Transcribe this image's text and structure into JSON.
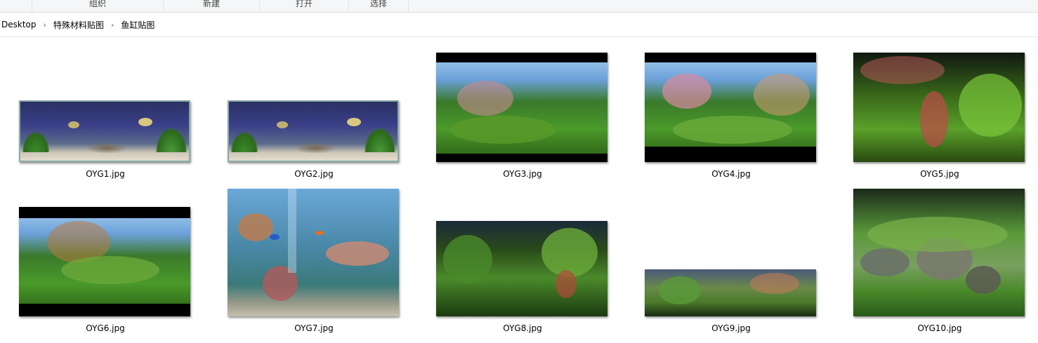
{
  "ribbon": {
    "groups": [
      "",
      "组织",
      "新建",
      "打开",
      "选择"
    ]
  },
  "address": {
    "crumbs": [
      "Desktop",
      "特殊材料贴图",
      "鱼缸贴图"
    ]
  },
  "files": [
    {
      "name": "OYG1.jpg"
    },
    {
      "name": "OYG2.jpg"
    },
    {
      "name": "OYG3.jpg"
    },
    {
      "name": "OYG4.jpg"
    },
    {
      "name": "OYG5.jpg"
    },
    {
      "name": "OYG6.jpg"
    },
    {
      "name": "OYG7.jpg"
    },
    {
      "name": "OYG8.jpg"
    },
    {
      "name": "OYG9.jpg"
    },
    {
      "name": "OYG10.jpg"
    }
  ],
  "colors": {
    "ribbon_bg": "#f5f6f7",
    "address_border": "#e5e5e5"
  }
}
